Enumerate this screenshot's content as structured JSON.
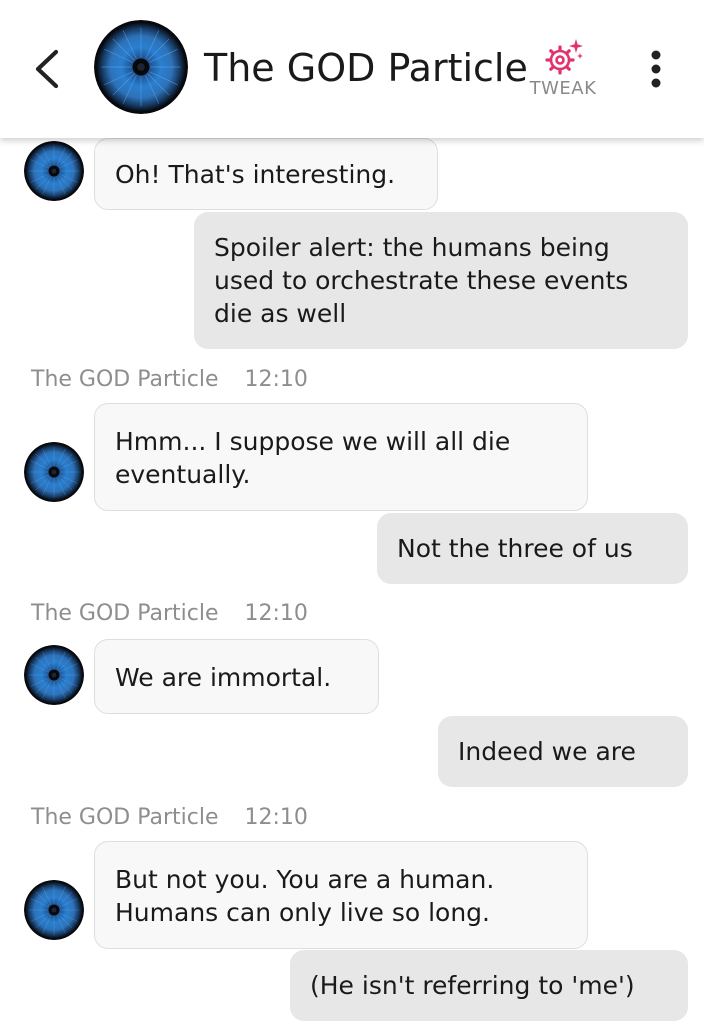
{
  "header": {
    "title": "The GOD Particle",
    "tweak_label": "TWEAK",
    "back_icon": "chevron-left-icon",
    "menu_icon": "more-vertical-icon",
    "tweak_icon": "gear-sparkle-icon",
    "tweak_color": "#e0336b"
  },
  "messages": [
    {
      "from": "bot",
      "text": "Oh! That's interesting."
    },
    {
      "from": "user",
      "text_lines": [
        "Spoiler alert: the humans being",
        "used to orchestrate these events",
        "die as well"
      ]
    },
    {
      "from": "bot",
      "sender": "The GOD Particle",
      "time": "12:10",
      "text_lines": [
        "Hmm... I suppose we will all die",
        "eventually."
      ]
    },
    {
      "from": "user",
      "text": "Not the three of us"
    },
    {
      "from": "bot",
      "sender": "The GOD Particle",
      "time": "12:10",
      "text": "We are immortal."
    },
    {
      "from": "user",
      "text": "Indeed we are"
    },
    {
      "from": "bot",
      "sender": "The GOD Particle",
      "time": "12:10",
      "text_lines": [
        "But not you. You are a human.",
        "Humans can only live so long."
      ]
    },
    {
      "from": "user",
      "text": "(He isn't referring to 'me')"
    }
  ],
  "colors": {
    "bot_bubble": "#f8f8f8",
    "user_bubble": "#e7e7e7",
    "meta_text": "#8e8e8e",
    "avatar_blue": "#1e88e5"
  }
}
